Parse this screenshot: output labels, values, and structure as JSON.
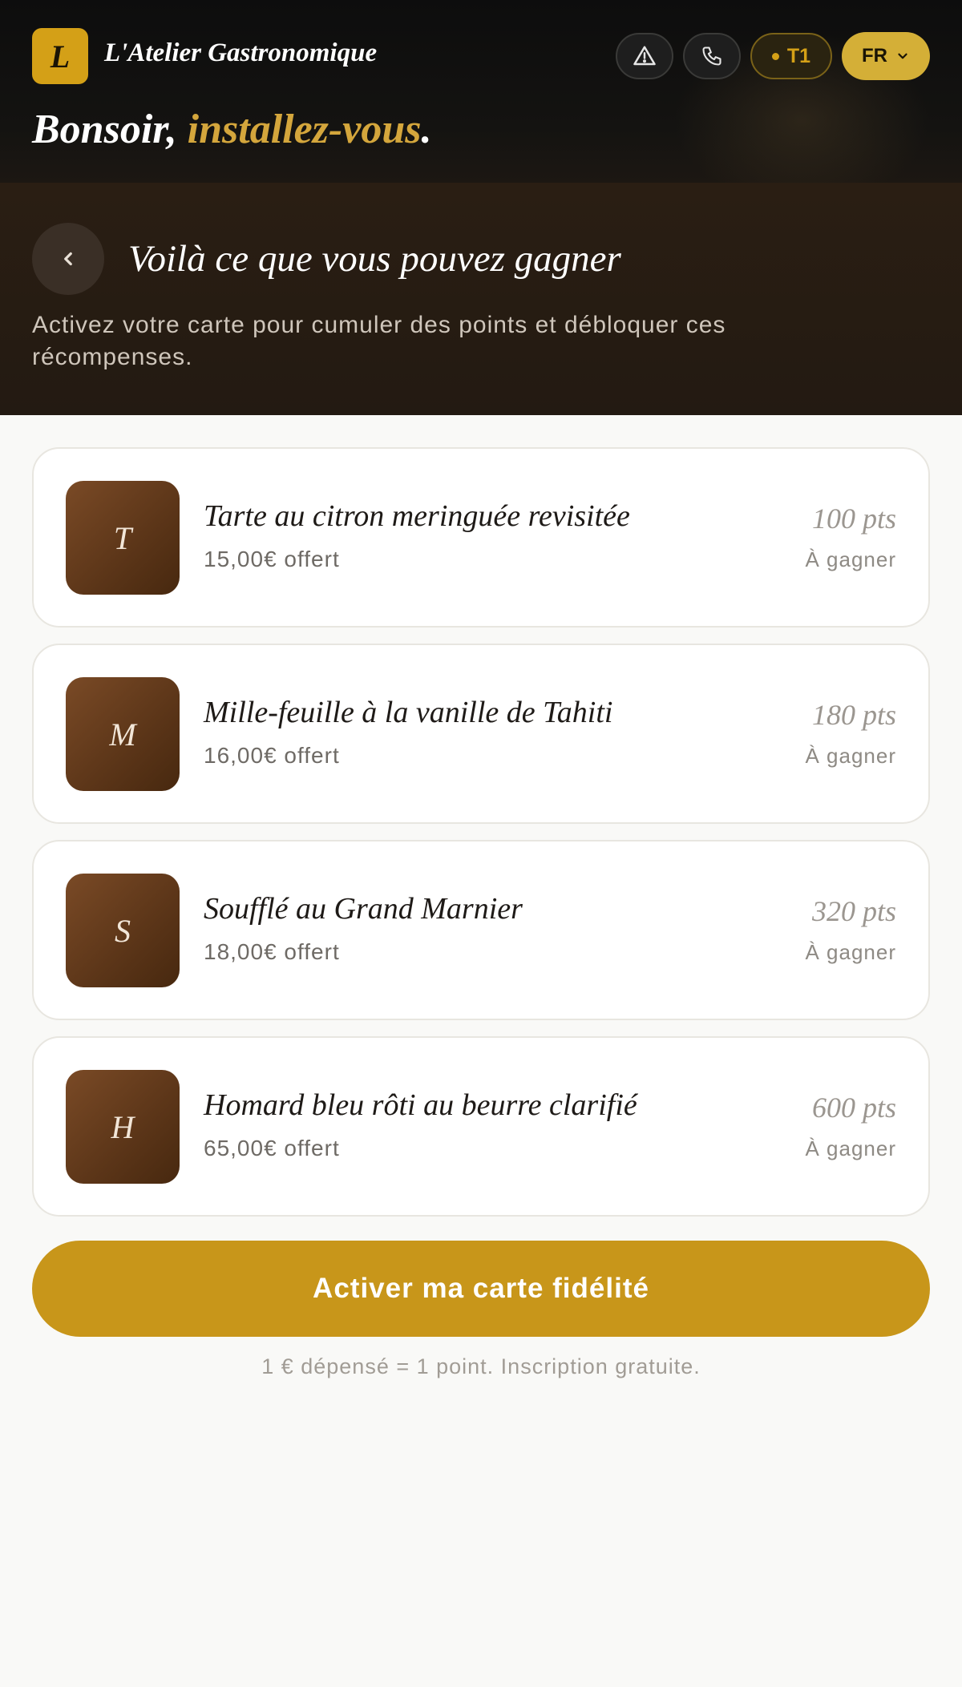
{
  "brand": {
    "logo_letter": "L",
    "name": "L'Atelier Gastronomique"
  },
  "header": {
    "actions": {
      "alert_icon": "warning-triangle-icon",
      "phone_icon": "phone-icon",
      "table_label": "T1",
      "language": "FR"
    },
    "greeting_main": "Bonsoir, ",
    "greeting_accent": "installez-vous",
    "greeting_end": "."
  },
  "hero": {
    "title": "Voilà ce que vous pouvez gagner",
    "subtitle": "Activez votre carte pour cumuler des points et débloquer ces récompenses."
  },
  "rewards": [
    {
      "letter": "T",
      "title": "Tarte au citron meringuée revisitée",
      "value": "15,00€ offert",
      "points": "100 pts",
      "status": "À gagner"
    },
    {
      "letter": "M",
      "title": "Mille-feuille à la vanille de Tahiti",
      "value": "16,00€ offert",
      "points": "180 pts",
      "status": "À gagner"
    },
    {
      "letter": "S",
      "title": "Soufflé au Grand Marnier",
      "value": "18,00€ offert",
      "points": "320 pts",
      "status": "À gagner"
    },
    {
      "letter": "H",
      "title": "Homard bleu rôti au beurre clarifié",
      "value": "65,00€ offert",
      "points": "600 pts",
      "status": "À gagner"
    }
  ],
  "cta": {
    "label": "Activer ma carte fidélité"
  },
  "footnote": "1 € dépensé = 1 point. Inscription gratuite.",
  "colors": {
    "gold": "#d4a017",
    "cta": "#c8961a",
    "dark": "#141311",
    "brown": "#5b3518"
  }
}
